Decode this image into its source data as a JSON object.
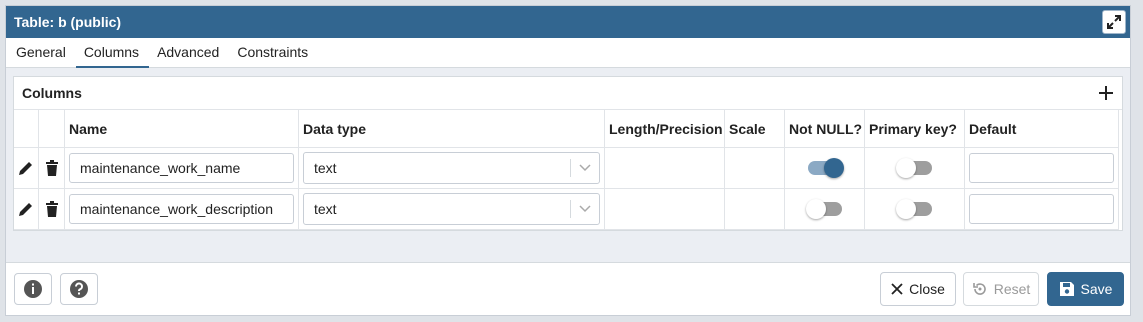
{
  "dialog": {
    "title": "Table: b (public)"
  },
  "tabs": [
    {
      "label": "General"
    },
    {
      "label": "Columns"
    },
    {
      "label": "Advanced"
    },
    {
      "label": "Constraints"
    }
  ],
  "active_tab": "Columns",
  "columns_panel": {
    "title": "Columns",
    "headers": [
      "Name",
      "Data type",
      "Length/Precision",
      "Scale",
      "Not NULL?",
      "Primary key?",
      "Default"
    ],
    "rows": [
      {
        "name": "maintenance_work_name",
        "data_type": "text",
        "length": "",
        "scale": "",
        "not_null": true,
        "primary_key": false,
        "default": ""
      },
      {
        "name": "maintenance_work_description",
        "data_type": "text",
        "length": "",
        "scale": "",
        "not_null": false,
        "primary_key": false,
        "default": ""
      }
    ]
  },
  "footer": {
    "close_label": "Close",
    "reset_label": "Reset",
    "save_label": "Save"
  },
  "colors": {
    "primary": "#326690",
    "toggle_on_track": "#8ba9c4",
    "toggle_off_track": "#9e9e9e"
  },
  "icons": [
    "expand-icon",
    "add-icon",
    "edit-icon",
    "delete-icon",
    "chevron-down-icon",
    "info-icon",
    "help-icon",
    "close-icon",
    "reset-icon",
    "save-icon"
  ]
}
